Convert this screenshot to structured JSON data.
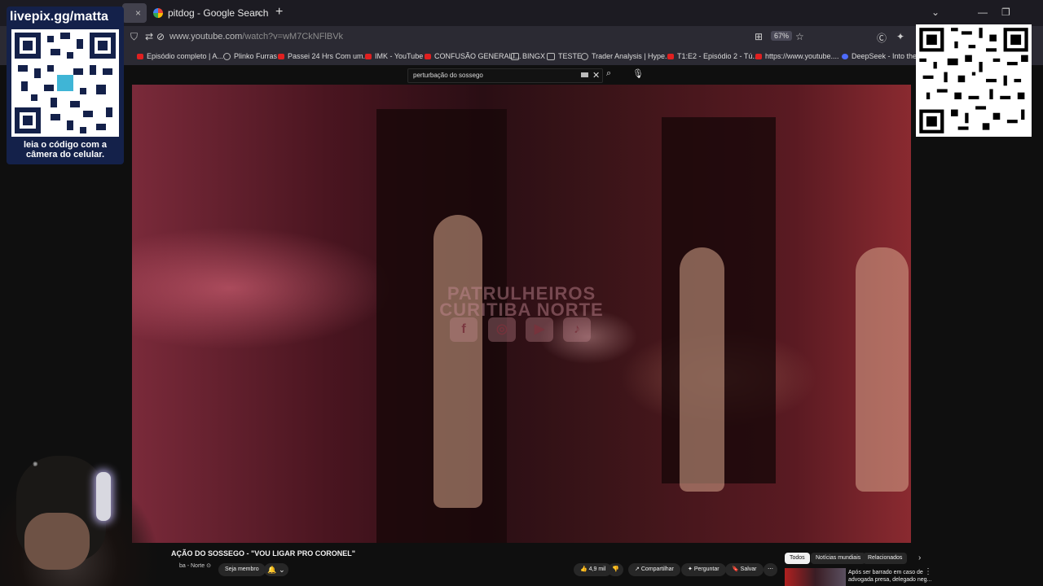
{
  "browser": {
    "tabs": [
      {
        "label": "",
        "active": true
      },
      {
        "label": "pitdog - Google Search",
        "active": false
      }
    ],
    "new_tab_symbol": "+",
    "url": {
      "host": "www.youtube.com",
      "path": "/watch?v=wM7CkNFlBVk"
    },
    "zoom": "67%",
    "bookmarks": [
      {
        "label": "Episódio completo | A...",
        "icon": "youtube-icon"
      },
      {
        "label": "Plinko Furras",
        "icon": "globe-icon"
      },
      {
        "label": "Passei 24 Hrs Com um...",
        "icon": "youtube-icon"
      },
      {
        "label": "IMK - YouTube",
        "icon": "youtube-icon"
      },
      {
        "label": "CONFUSÃO GENERALI...",
        "icon": "youtube-icon"
      },
      {
        "label": "BINGX",
        "icon": "folder-icon"
      },
      {
        "label": "TESTE",
        "icon": "folder-icon"
      },
      {
        "label": "Trader Analysis | Hype...",
        "icon": "globe-icon"
      },
      {
        "label": "T1:E2 - Episódio 2 - Tú...",
        "icon": "youtube-icon"
      },
      {
        "label": "https://www.youtube....",
        "icon": "youtube-icon"
      },
      {
        "label": "DeepSeek - Into the U",
        "icon": "deepseek-icon"
      }
    ]
  },
  "youtube": {
    "search_query": "perturbação do sossego",
    "video": {
      "watermark_line1": "PATRULHEIROS",
      "watermark_line2": "CURITIBA NORTE"
    },
    "title": "AÇÃO DO SOSSEGO - \"VOU LIGAR PRO CORONEL\"",
    "channel": "ba - Norte ⊙",
    "join_label": "Seja membro",
    "actions": {
      "likes": "4,9 mil",
      "share": "Compartilhar",
      "ask": "Perguntar",
      "save": "Salvar"
    },
    "chips": [
      "Todos",
      "Notícias mundiais",
      "Relacionados"
    ],
    "recommendation": {
      "title_line1": "Após ser barrado em caso de",
      "title_line2": "advogada presa, delegado neg..."
    }
  },
  "overlay": {
    "qr_left_title": "livepix.gg/matta",
    "qr_left_caption_line1": "leia o código com a",
    "qr_left_caption_line2": "câmera do celular."
  }
}
